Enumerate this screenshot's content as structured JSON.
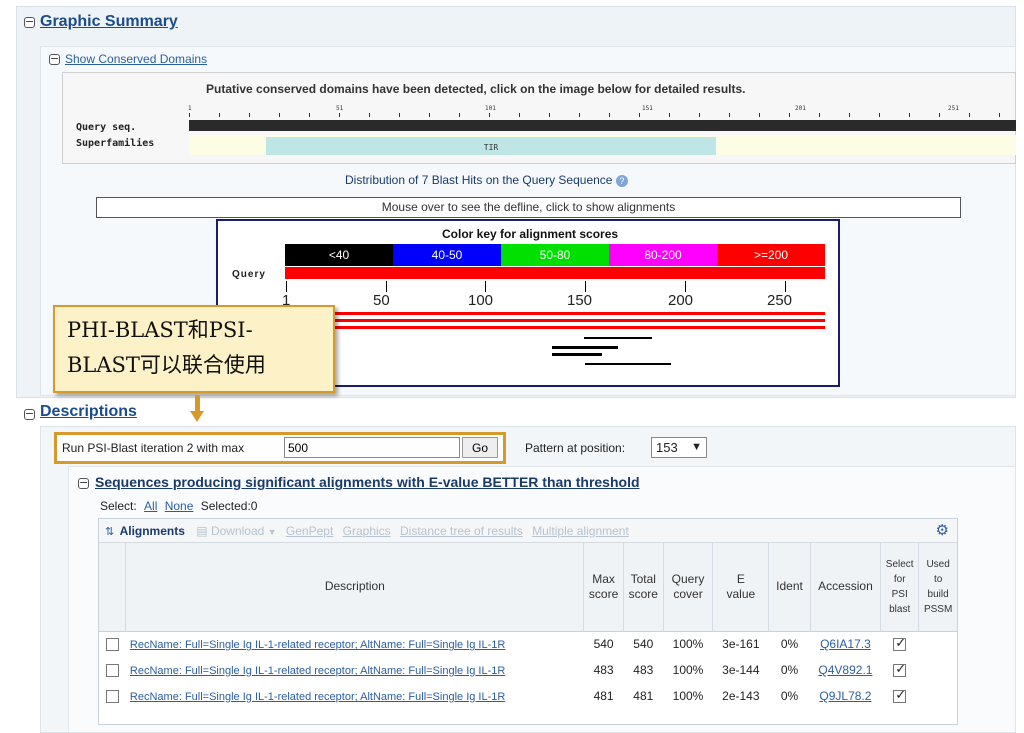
{
  "graphic_summary": {
    "title": "Graphic Summary",
    "show_cdd_link": "Show Conserved Domains",
    "cdd_message": "Putative conserved domains have been detected, click on the image below for detailed results.",
    "query_label": "Query seq.",
    "superfamilies_label": "Superfamilies",
    "ticks": [
      "1",
      "51",
      "101",
      "151",
      "201",
      "251"
    ],
    "domain_name": "TIR",
    "distribution_title": "Distribution of 7 Blast Hits on the Query Sequence",
    "mouse_over_text": "Mouse over to see the defline, click to show alignments",
    "color_key_title": "Color key for alignment scores",
    "color_key": [
      {
        "label": "<40",
        "color": "#000000"
      },
      {
        "label": "40-50",
        "color": "#0000ff"
      },
      {
        "label": "50-80",
        "color": "#00e000"
      },
      {
        "label": "80-200",
        "color": "#ff00ff"
      },
      {
        "label": ">=200",
        "color": "#ff0000"
      }
    ],
    "query_word": "Query",
    "axis_ticks": [
      "1",
      "50",
      "100",
      "150",
      "200",
      "250"
    ]
  },
  "callout": {
    "line1": "PHI-BLAST和PSI-",
    "line2": "BLAST可以联合使用"
  },
  "descriptions": {
    "title": "Descriptions",
    "run_psi_label": "Run PSI-Blast iteration 2 with max",
    "run_psi_value": "500",
    "go_label": "Go",
    "pattern_label": "Pattern at position:",
    "pattern_value": "153",
    "seq_header": "Sequences producing significant alignments with E-value BETTER than threshold",
    "select_label": "Select:",
    "select_all": "All",
    "select_none": "None",
    "selected_count": "Selected:0",
    "toolbar": {
      "alignments": "Alignments",
      "download": "Download",
      "genpept": "GenPept",
      "graphics": "Graphics",
      "distance_tree": "Distance tree of results",
      "multiple_alignment": "Multiple alignment"
    },
    "columns": {
      "description": "Description",
      "max_score": [
        "Max",
        "score"
      ],
      "total_score": [
        "Total",
        "score"
      ],
      "query_cover": [
        "Query",
        "cover"
      ],
      "e_value": [
        "E",
        "value"
      ],
      "ident": "Ident",
      "accession": "Accession",
      "select_psi": [
        "Select",
        "for",
        "PSI",
        "blast"
      ],
      "used_pssm": [
        "Used",
        "to",
        "build",
        "PSSM"
      ]
    },
    "rows": [
      {
        "description": "RecName: Full=Single Ig IL-1-related receptor; AltName: Full=Single Ig IL-1R",
        "max": "540",
        "total": "540",
        "cover": "100%",
        "evalue": "3e-161",
        "ident": "0%",
        "accession": "Q6IA17.3"
      },
      {
        "description": "RecName: Full=Single Ig IL-1-related receptor; AltName: Full=Single Ig IL-1R",
        "max": "483",
        "total": "483",
        "cover": "100%",
        "evalue": "3e-144",
        "ident": "0%",
        "accession": "Q4V892.1"
      },
      {
        "description": "RecName: Full=Single Ig IL-1-related receptor; AltName: Full=Single Ig IL-1R",
        "max": "481",
        "total": "481",
        "cover": "100%",
        "evalue": "2e-143",
        "ident": "0%",
        "accession": "Q9JL78.2"
      }
    ]
  }
}
